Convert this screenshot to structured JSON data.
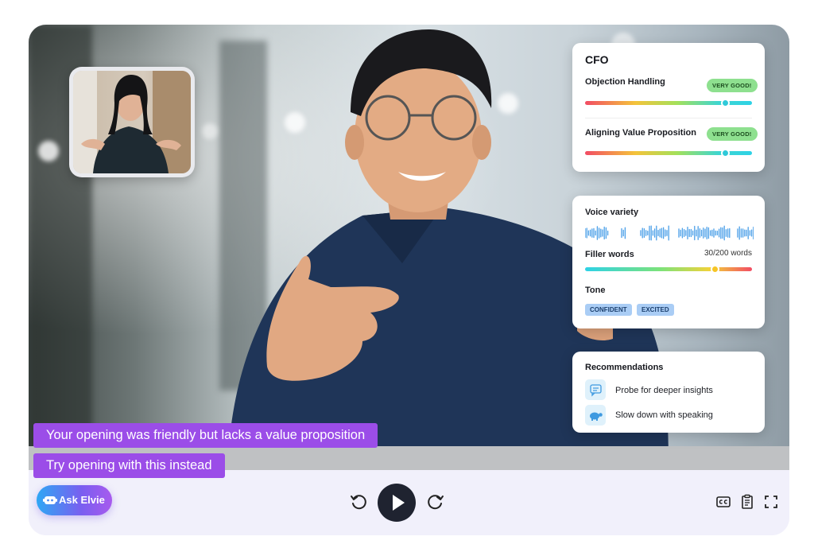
{
  "scorecard": {
    "title": "CFO",
    "metrics": [
      {
        "label": "Objection Handling",
        "badge": "VERY GOOD!",
        "level": 0.84
      },
      {
        "label": "Aligning Value Proposition",
        "badge": "VERY GOOD!",
        "level": 0.84
      }
    ]
  },
  "voice": {
    "voice_variety_label": "Voice variety",
    "filler_label": "Filler words",
    "filler_value": "30/200 words",
    "filler_level": 0.78,
    "tone_label": "Tone",
    "tones": [
      "CONFIDENT",
      "EXCITED"
    ]
  },
  "recommendations": {
    "title": "Recommendations",
    "items": [
      {
        "icon": "chat-bubble-icon",
        "text": "Probe for deeper insights"
      },
      {
        "icon": "turtle-icon",
        "text": "Slow down with speaking"
      }
    ]
  },
  "captions": [
    "Your opening was friendly but lacks a value proposition",
    "Try opening with this instead"
  ],
  "controls": {
    "ask_label": "Ask Elvie",
    "left_icons": [
      "robot-icon"
    ],
    "center_icons": [
      "rewind-icon",
      "play-icon",
      "forward-icon"
    ],
    "right_icons": [
      "closed-captions-icon",
      "transcript-icon",
      "fullscreen-icon"
    ]
  },
  "colors": {
    "caption_bg": "#9b4de8",
    "badge_bg": "#8ee08f",
    "tone_tag_bg": "#aacdf5",
    "controls_bg": "#f1f0fb",
    "play_button": "#1f2330",
    "knob_teal": "#2fc9d9",
    "knob_yellow": "#f6c526"
  }
}
